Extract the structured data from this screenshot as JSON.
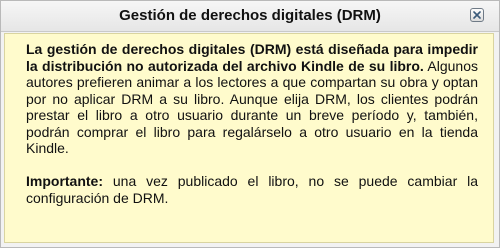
{
  "dialog": {
    "title": "Gestión de derechos digitales (DRM)",
    "close_icon": "close-icon",
    "paragraph1_bold": "La gestión de derechos digitales (DRM) está diseñada para impedir la distribución no autorizada del archivo Kindle de su libro.",
    "paragraph1_rest": " Algunos autores prefieren animar a los lectores a que compartan su obra y optan por no aplicar DRM a su libro. Aunque elija DRM, los clientes podrán prestar el libro a otro usuario durante un breve período y, también, podrán comprar el libro para regalárselo a otro usuario en la tienda Kindle.",
    "paragraph2_label": "Importante:",
    "paragraph2_rest": " una vez publicado el libro, no se puede cambiar la configuración de DRM."
  },
  "colors": {
    "content_background": "#fffbcc",
    "titlebar_background": "#eeeeee",
    "close_icon_color": "#3a5a7a"
  }
}
